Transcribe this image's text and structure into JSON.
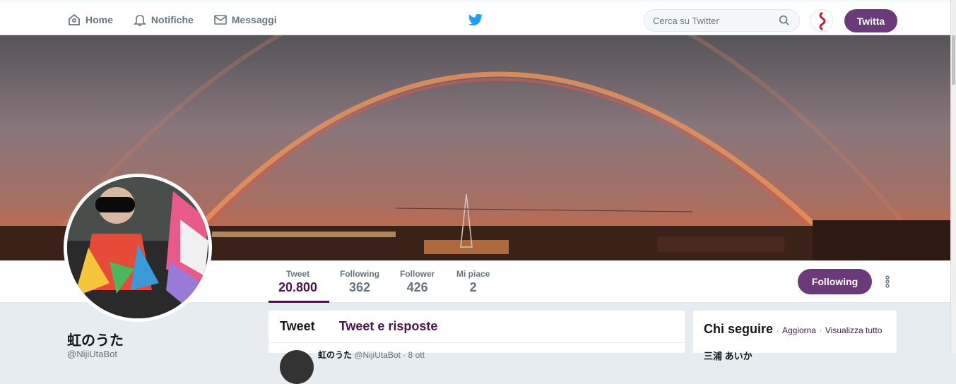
{
  "nav": {
    "home_label": "Home",
    "notifications_label": "Notifiche",
    "messages_label": "Messaggi"
  },
  "search": {
    "placeholder": "Cerca su Twitter"
  },
  "header": {
    "tweet_button": "Twitta"
  },
  "stats": [
    {
      "label": "Tweet",
      "value": "20.800"
    },
    {
      "label": "Following",
      "value": "362"
    },
    {
      "label": "Follower",
      "value": "426"
    },
    {
      "label": "Mi piace",
      "value": "2"
    }
  ],
  "profile": {
    "name": "虹のうた",
    "handle": "@NijiUtaBot",
    "follow_button": "Following"
  },
  "timeline": {
    "tabs": [
      "Tweet",
      "Tweet e risposte"
    ],
    "first_item_name": "虹のうた",
    "first_item_meta": "@NijiUtaBot · 8 ott"
  },
  "who_to_follow": {
    "title": "Chi seguire",
    "refresh": "Aggiorna",
    "view_all": "Visualizza tutto",
    "first_name": "三浦 あいか"
  },
  "colors": {
    "accent": "#6b3a78",
    "accent_dark": "#4a154b",
    "twitter_blue": "#1da1f2",
    "muted": "#66757f"
  }
}
